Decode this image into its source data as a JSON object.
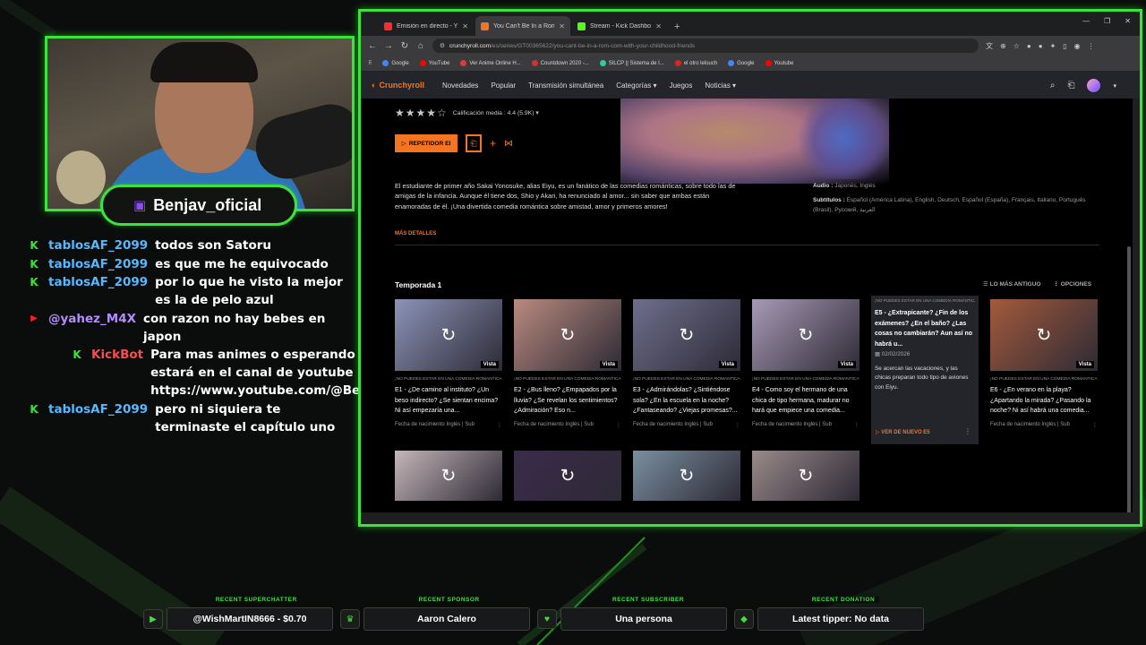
{
  "streamer": {
    "name": "Benjav_oficial",
    "platform_icon": "twitch-icon"
  },
  "chat": [
    {
      "platform": "kick",
      "user": "tablosAF_2099",
      "message": "todos son Satoru"
    },
    {
      "platform": "kick",
      "user": "tablosAF_2099",
      "message": "es que me he equivocado"
    },
    {
      "platform": "kick",
      "user": "tablosAF_2099",
      "message": "por lo que he visto la mejor es la de pelo azul"
    },
    {
      "platform": "youtube",
      "user": "@yahez_M4X",
      "message": "con razon no hay bebes en japon"
    },
    {
      "platform": "kick",
      "user": "KickBot",
      "message": "Para mas animes o esperando anime estará en el canal de youtube https://www.youtube.com/@Benjavoficial"
    },
    {
      "platform": "kick",
      "user": "tablosAF_2099",
      "message": "pero ni siquiera te terminaste el capítulo uno"
    }
  ],
  "browser": {
    "tabs": [
      {
        "label": "Emisión en directo - YouTube S",
        "color": "#ff2a2a",
        "active": false
      },
      {
        "label": "You Can't Be In a Rom-Com wi",
        "color": "#f47521",
        "active": true
      },
      {
        "label": "Stream - Kick Dashboard",
        "color": "#53fc18",
        "active": false
      }
    ],
    "url_host": "crunchyroll.com",
    "url_path": "/es/series/GT00365622/you-cant-be-in-a-rom-com-with-your-childhood-friends",
    "bookmarks": [
      {
        "label": "Google",
        "color": "#4285f4"
      },
      {
        "label": "YouTube",
        "color": "#ff0000"
      },
      {
        "label": "Ver Anime Online H...",
        "color": "#e03a3a"
      },
      {
        "label": "Countdown 2020 -...",
        "color": "#c33"
      },
      {
        "label": "SILCP || Sistema de I...",
        "color": "#3c9"
      },
      {
        "label": "el otro lelouch",
        "color": "#d22"
      },
      {
        "label": "Google",
        "color": "#4285f4"
      },
      {
        "label": "Youtube",
        "color": "#ff0000"
      }
    ]
  },
  "crunchyroll": {
    "logo": "Crunchyroll",
    "nav": [
      "Novedades",
      "Popular",
      "Transmisión simultánea",
      "Categorías ▾",
      "Juegos",
      "Noticias ▾"
    ],
    "rating_label": "Calificación media : 4.4 (5.9K) ▾",
    "play_button": "REPETIDOR EI",
    "description": "El estudiante de primer año Sakai Yonosuke, alias Eiyu, es un fanático de las comedias románticas, sobre todo las de amigas de la infancia. Aunque él tiene dos, Shio y Akari, ha renunciado al amor... sin saber que ambas están enamoradas de él. ¡Una divertida comedia romántica sobre amistad, amor y primeros amores!",
    "audio_label": "Audio :",
    "audio_value": "Japonés, Inglés",
    "subtitles_label": "Subtítulos :",
    "subtitles_value": "Español (América Latina), English, Deutsch, Español (España), Français, Italiano, Português (Brasil), Pусский, العربية",
    "more_details": "MÁS DETALLES",
    "season": "Temporada 1",
    "sort_label": "LO MÁS ANTIGUO",
    "options_label": "OPCIONES",
    "series_caption": "¡NO PUEDES ESTAR EN UNA COMEDIA ROMÁNTICA CON...",
    "watched_badge": "Vista",
    "ep_footer": "Fecha de nacimiento Inglés | Sub",
    "episodes": [
      {
        "title": "E1 - ¿De camino al instituto? ¿Un beso indirecto? ¿Se sientan encima? Ni así empezaría una...",
        "thumb": "#8b94b8"
      },
      {
        "title": "E2 - ¿Bus lleno? ¿Empapados por la lluvia? ¿Se revelan los sentimientos? ¿Admiración? Eso n...",
        "thumb": "#b98a7f"
      },
      {
        "title": "E3 - ¿Admirándolas? ¿Sintiéndose sola? ¿En la escuela en la noche? ¿Fantaseando? ¿Viejas promesas?...",
        "thumb": "#6f6f8e"
      },
      {
        "title": "E4 - Como soy el hermano de una chica de tipo hermana, madurar no hará que empiece una comedia...",
        "thumb": "#a89ab6"
      },
      {
        "title": "E6 - ¿En verano en la playa? ¿Apartando la mirada? ¿Pasando la noche? Ni así habrá una comedia...",
        "thumb": "#a35a3c"
      }
    ],
    "hover_episode": {
      "title": "E5 - ¿Extrapicante? ¿Fin de los exámenes? ¿En el baño? ¿Las cosas no cambiarán? Aun así no habrá u...",
      "date": "02/02/2026",
      "synopsis": "Se acercan las vacaciones, y las chicas preparan todo tipo de aviones con Eiyu.",
      "cta": "VER DE NUEVO E5"
    },
    "row2_thumbs": [
      "#c5b6b9",
      "#3b2b4a",
      "#7a8fa0",
      "#9a8a8a"
    ]
  },
  "alerts": [
    {
      "tag": "RECENT SUPERCHATTER",
      "value": "@WishMartIN8666 - $0.70",
      "icon": "youtube-icon"
    },
    {
      "tag": "RECENT SPONSOR",
      "value": "Aaron Calero",
      "icon": "crown-icon"
    },
    {
      "tag": "RECENT SUBSCRIBER",
      "value": "Una persona",
      "icon": "heart-icon"
    },
    {
      "tag": "RECENT DONATION",
      "value": "Latest tipper: No data",
      "icon": "money-bag-icon"
    }
  ]
}
